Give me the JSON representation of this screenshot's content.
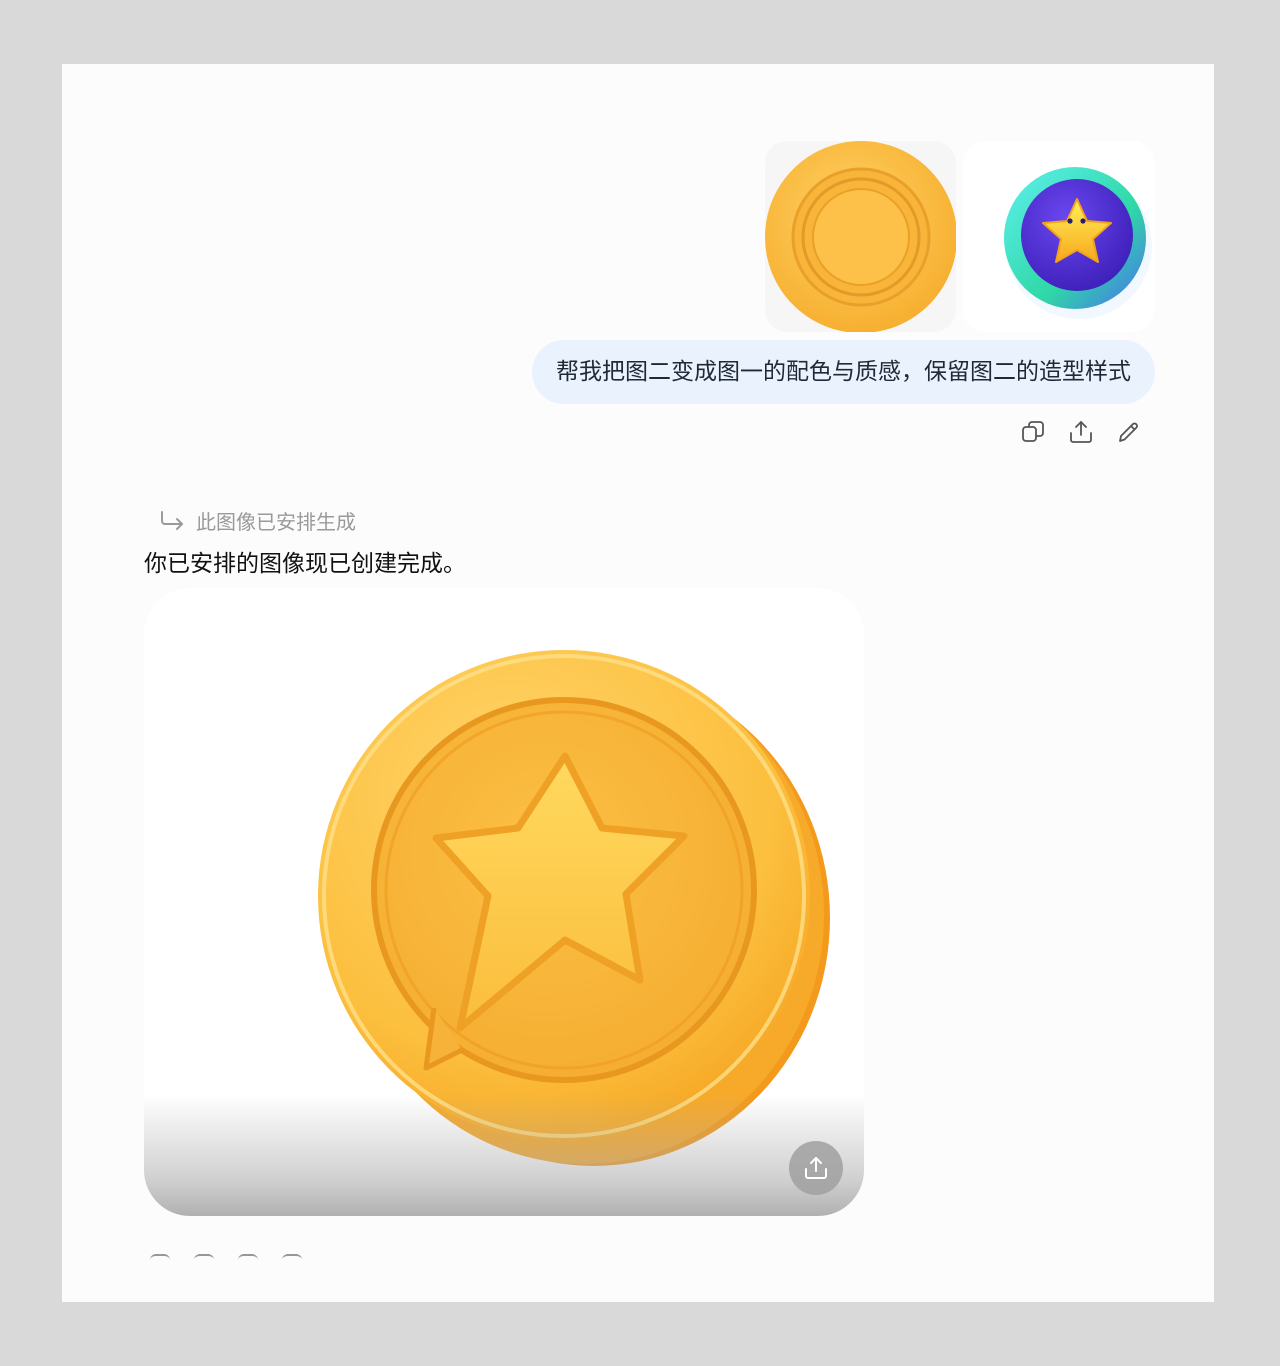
{
  "user_message": {
    "text": "帮我把图二变成图一的配色与质感，保留图二的造型样式",
    "attachments": [
      {
        "name": "golden-coin-reference"
      },
      {
        "name": "star-badge-reference"
      }
    ]
  },
  "user_actions": [
    "copy-icon",
    "share-icon",
    "edit-icon"
  ],
  "assistant": {
    "note": "此图像已安排生成",
    "message": "你已安排的图像现已创建完成。",
    "image": {
      "name": "golden-star-coin"
    },
    "share_icon": "share-icon"
  },
  "colors": {
    "bubble": "#e9f2fd",
    "gold": "#fbbf3c",
    "gold_dark": "#f0a020",
    "purple": "#5b3fe0",
    "teal": "#3fe0c8"
  }
}
